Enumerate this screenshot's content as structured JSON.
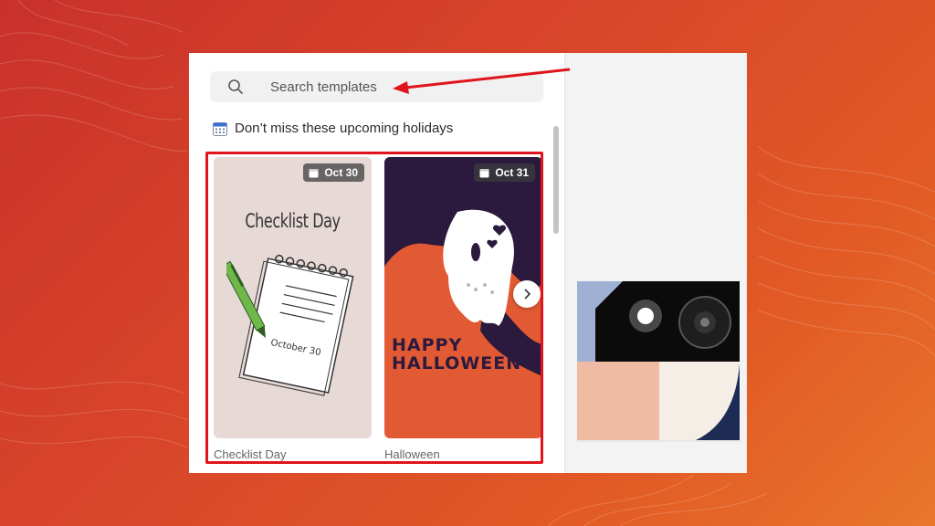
{
  "search": {
    "placeholder": "Search templates"
  },
  "section": {
    "title": "Don’t miss these upcoming holidays"
  },
  "cards": [
    {
      "date": "Oct 30",
      "heading": "Checklist Day",
      "notebook_text": "October 30",
      "label": "Checklist Day"
    },
    {
      "date": "Oct 31",
      "heading_line1": "HAPPY",
      "heading_line2": "HALLOWEEN",
      "label": "Halloween"
    }
  ],
  "icons": {
    "search": "search-icon",
    "calendar": "calendar-icon",
    "next": "chevron-right-icon"
  },
  "colors": {
    "annotation": "#e0141c",
    "halloween_bg": "#e25a33",
    "halloween_purple": "#2b1a3d",
    "checklist_bg": "#e6d9d6"
  }
}
